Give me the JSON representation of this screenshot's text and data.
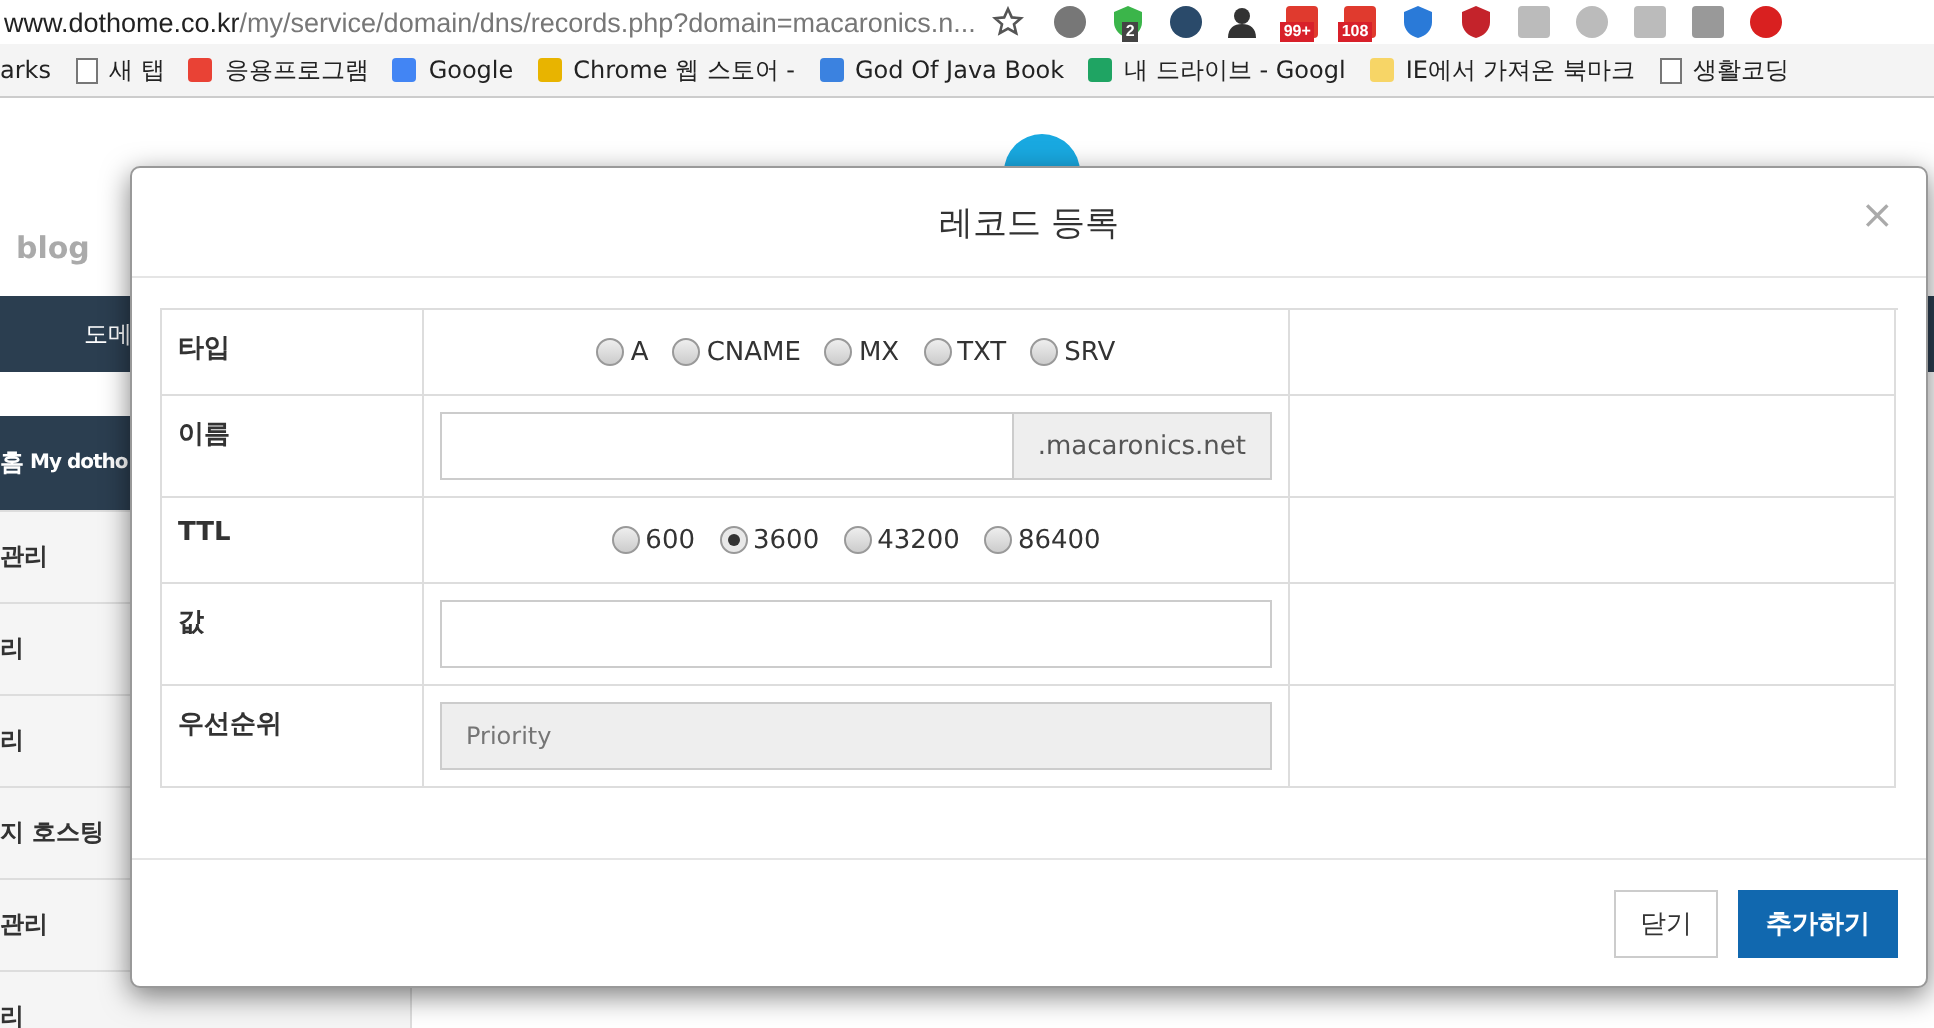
{
  "browser": {
    "url_host": "www.dothome.co.kr",
    "url_path": "/my/service/domain/dns/records.php?domain=macaronics.n...",
    "extension_badges": [
      "2",
      "99+",
      "108"
    ],
    "bookmarks": [
      {
        "label": "arks"
      },
      {
        "label": "새 탭"
      },
      {
        "label": "응용프로그램"
      },
      {
        "label": "Google"
      },
      {
        "label": "Chrome 웹 스토어 -"
      },
      {
        "label": "God Of Java Book"
      },
      {
        "label": "내 드라이브 - Googl"
      },
      {
        "label": "IE에서 가져온 북마크"
      },
      {
        "label": "생활코딩"
      }
    ]
  },
  "background_page": {
    "logo_text": "blog",
    "nav_text": "도메",
    "sidebar_items": [
      {
        "text": "홈",
        "subtext": "My dotho",
        "selected": true
      },
      {
        "text": "관리",
        "selected": false
      },
      {
        "text": "리",
        "selected": false
      },
      {
        "text": "리",
        "selected": false
      },
      {
        "text": "지 호스팅",
        "selected": false
      },
      {
        "text": "관리",
        "selected": false
      },
      {
        "text": "리",
        "selected": false
      }
    ]
  },
  "dialog": {
    "title": "레코드 등록",
    "close": "×",
    "fields": [
      {
        "label": "타입",
        "kind": "radio",
        "options": [
          {
            "label": "A",
            "selected": false
          },
          {
            "label": "CNAME",
            "selected": false
          },
          {
            "label": "MX",
            "selected": false
          },
          {
            "label": "TXT",
            "selected": false
          },
          {
            "label": "SRV",
            "selected": false
          }
        ]
      },
      {
        "label": "이름",
        "kind": "suffix",
        "suffix": ".macaronics.net"
      },
      {
        "label": "TTL",
        "kind": "radio",
        "options": [
          {
            "label": "600",
            "selected": false
          },
          {
            "label": "3600",
            "selected": true
          },
          {
            "label": "43200",
            "selected": false
          },
          {
            "label": "86400",
            "selected": false
          }
        ]
      },
      {
        "label": "값",
        "kind": "input"
      },
      {
        "label": "우선순위",
        "kind": "disabled",
        "placeholder": "Priority"
      }
    ],
    "buttons": [
      {
        "label": "닫기",
        "kind": "secondary"
      },
      {
        "label": "추가하기",
        "kind": "primary"
      }
    ]
  }
}
